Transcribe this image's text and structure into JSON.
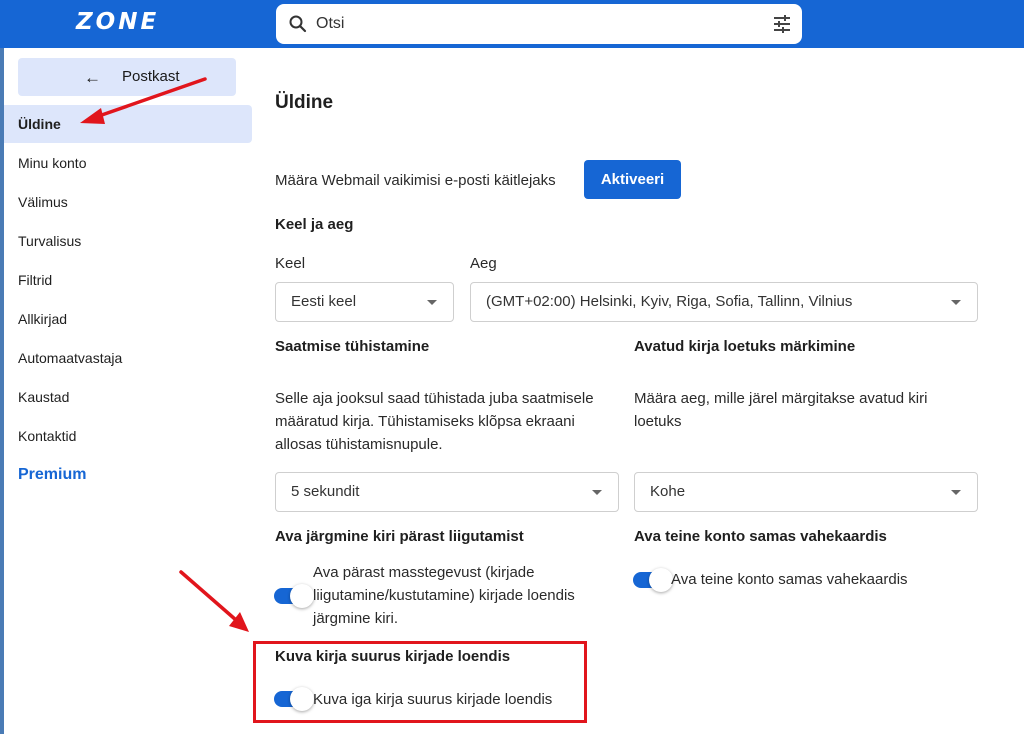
{
  "app": {
    "logo": "ZONE",
    "accent": "#1666d4",
    "highlight_color": "#e1151c"
  },
  "search": {
    "placeholder": "Otsi",
    "search_icon": "search-icon",
    "filter_icon": "filter-sliders-icon"
  },
  "sidebar": {
    "back_label": "Postkast",
    "back_icon": "arrow-left-icon",
    "items": [
      {
        "label": "Üldine",
        "active": true
      },
      {
        "label": "Minu konto"
      },
      {
        "label": "Välimus"
      },
      {
        "label": "Turvalisus"
      },
      {
        "label": "Filtrid"
      },
      {
        "label": "Allkirjad"
      },
      {
        "label": "Automaatvastaja"
      },
      {
        "label": "Kaustad"
      },
      {
        "label": "Kontaktid"
      },
      {
        "label": "Premium"
      }
    ]
  },
  "main": {
    "title": "Üldine",
    "default_client": {
      "text": "Määra Webmail vaikimisi e-posti käitlejaks",
      "button": "Aktiveeri"
    },
    "language_time": {
      "heading": "Keel ja aeg",
      "language_label": "Keel",
      "language_value": "Eesti keel",
      "time_label": "Aeg",
      "time_value": "(GMT+02:00) Helsinki, Kyiv, Riga, Sofia, Tallinn, Vilnius"
    },
    "undo_send": {
      "heading": "Saatmise tühistamine",
      "description_lines": [
        "Selle aja jooksul saad tühistada juba saatmisele",
        "määratud kirja. Tühistamiseks klõpsa ekraani",
        "allosas tühistamisnupule."
      ],
      "value": "5 sekundit"
    },
    "mark_read": {
      "heading": "Avatud kirja loetuks märkimine",
      "description_lines": [
        "Määra aeg, mille järel märgitakse avatud kiri",
        "loetuks"
      ],
      "value": "Kohe"
    },
    "open_next": {
      "heading": "Ava järgmine kiri pärast liigutamist",
      "toggle_lines": [
        "Ava pärast masstegevust (kirjade",
        "liigutamine/kustutamine) kirjade loendis",
        "järgmine kiri."
      ],
      "enabled": true
    },
    "other_account": {
      "heading": "Ava teine konto samas vahekaardis",
      "toggle_label": "Ava teine konto samas vahekaardis",
      "enabled": true
    },
    "message_size": {
      "heading": "Kuva kirja suurus kirjade loendis",
      "toggle_label": "Kuva iga kirja suurus kirjade loendis",
      "enabled": true
    }
  }
}
